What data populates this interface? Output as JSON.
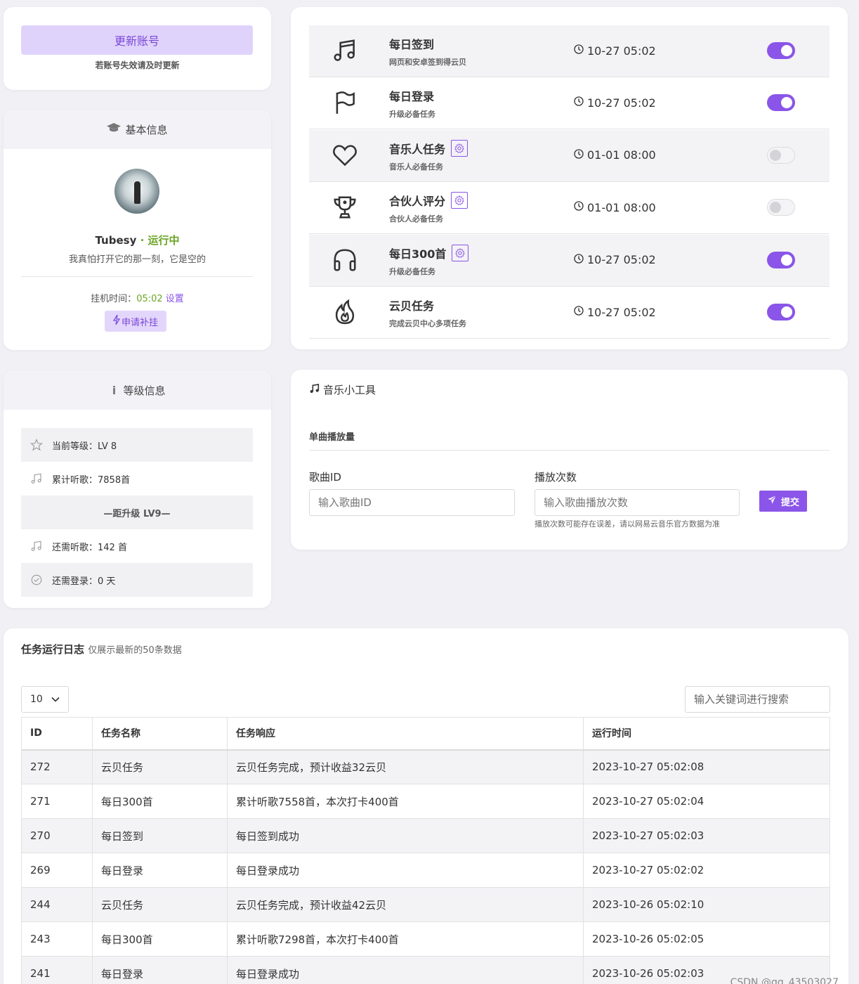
{
  "account": {
    "update_button": "更新账号",
    "hint": "若账号失效请及时更新"
  },
  "basic": {
    "title": "基本信息",
    "username": "Tubesy",
    "separator": " · ",
    "status": "运行中",
    "motto": "我真怕打开它的那一刻，它是空的",
    "hang_label": "挂机时间：",
    "hang_time": "05:02",
    "set_link": "设置",
    "apply_button": "申请补挂"
  },
  "level": {
    "title": "等级信息",
    "current_level": "当前等级：LV 8",
    "total_listened": "累计听歌：7858首",
    "next_level": "—距升级 LV9—",
    "need_songs": "还需听歌：142 首",
    "need_days": "还需登录：0 天"
  },
  "tasks": [
    {
      "name": "每日签到",
      "desc": "网页和安卓签到得云贝",
      "time": "10-27 05:02",
      "enabled": true,
      "icon": "music-note-icon",
      "gear": false
    },
    {
      "name": "每日登录",
      "desc": "升级必备任务",
      "time": "10-27 05:02",
      "enabled": true,
      "icon": "flag-icon",
      "gear": false
    },
    {
      "name": "音乐人任务",
      "desc": "音乐人必备任务",
      "time": "01-01 08:00",
      "enabled": false,
      "icon": "heart-icon",
      "gear": true
    },
    {
      "name": "合伙人评分",
      "desc": "合伙人必备任务",
      "time": "01-01 08:00",
      "enabled": false,
      "icon": "trophy-icon",
      "gear": true
    },
    {
      "name": "每日300首",
      "desc": "升级必备任务",
      "time": "10-27 05:02",
      "enabled": true,
      "icon": "headphones-icon",
      "gear": true
    },
    {
      "name": "云贝任务",
      "desc": "完成云贝中心多项任务",
      "time": "10-27 05:02",
      "enabled": true,
      "icon": "fire-icon",
      "gear": false
    }
  ],
  "tool": {
    "title": "音乐小工具",
    "section": "单曲播放量",
    "song_id_label": "歌曲ID",
    "song_id_placeholder": "输入歌曲ID",
    "count_label": "播放次数",
    "count_placeholder": "输入歌曲播放次数",
    "note": "播放次数可能存在误差，请以网易云音乐官方数据为准",
    "submit": "提交"
  },
  "logs": {
    "title": "任务运行日志",
    "subtitle": "仅展示最新的50条数据",
    "page_size": "10",
    "search_placeholder": "输入关键词进行搜索",
    "columns": [
      "ID",
      "任务名称",
      "任务响应",
      "运行时间"
    ],
    "rows": [
      [
        "272",
        "云贝任务",
        "云贝任务完成，预计收益32云贝",
        "2023-10-27 05:02:08"
      ],
      [
        "271",
        "每日300首",
        "累计听歌7558首，本次打卡400首",
        "2023-10-27 05:02:04"
      ],
      [
        "270",
        "每日签到",
        "每日签到成功",
        "2023-10-27 05:02:03"
      ],
      [
        "269",
        "每日登录",
        "每日登录成功",
        "2023-10-27 05:02:02"
      ],
      [
        "244",
        "云贝任务",
        "云贝任务完成，预计收益42云贝",
        "2023-10-26 05:02:10"
      ],
      [
        "243",
        "每日300首",
        "累计听歌7298首，本次打卡400首",
        "2023-10-26 05:02:05"
      ],
      [
        "241",
        "每日登录",
        "每日登录成功",
        "2023-10-26 05:02:03"
      ]
    ]
  },
  "watermark": "CSDN @qq_43503027",
  "colors": {
    "accent": "#8a55e8",
    "accent_light": "#e0d3fb",
    "success": "#6aa525"
  }
}
